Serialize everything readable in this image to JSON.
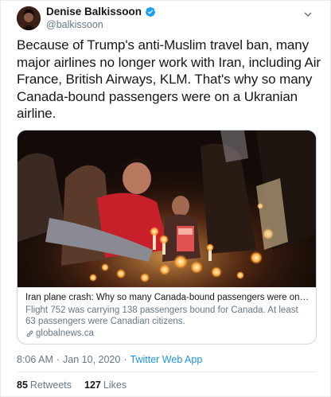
{
  "author": {
    "display_name": "Denise Balkissoon",
    "handle": "@balkissoon",
    "verified_icon": "verified-badge-icon",
    "avatar": "avatar-photo"
  },
  "tweet": {
    "text": "Because of Trump's anti-Muslim travel ban, many major airlines no longer work with Iran, including Air France, British Airways, KLM. That's why so many Canada-bound passengers were on a Ukranian airline."
  },
  "card": {
    "image": "candlelight-vigil-photo",
    "title": "Iran plane crash: Why so many Canada-bound passengers were on the flig...",
    "description": "Flight 752 was carrying 138 passengers bound for Canada. At least 63 passengers were Canadian citizens.",
    "domain": "globalnews.ca",
    "link_icon": "link-icon"
  },
  "meta": {
    "time": "8:06 AM",
    "separator": "·",
    "date": "Jan 10, 2020",
    "source": "Twitter Web App"
  },
  "stats": {
    "retweets_count": "85",
    "retweets_label": "Retweets",
    "likes_count": "127",
    "likes_label": "Likes"
  },
  "colors": {
    "link_blue": "#1b95e0",
    "secondary_text": "#657786",
    "border": "#e6ecf0"
  }
}
